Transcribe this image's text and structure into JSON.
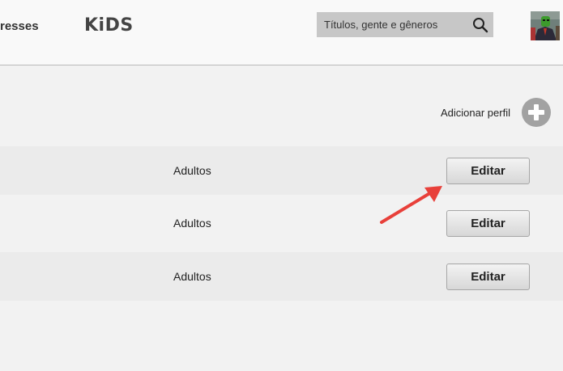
{
  "header": {
    "nav_partial": "resses",
    "kids_logo": "KiDS",
    "search": {
      "placeholder": "Títulos, gente e gêneros",
      "value": ""
    }
  },
  "add_profile": {
    "label": "Adicionar perfil",
    "icon": "plus-circle-icon"
  },
  "profiles": [
    {
      "type": "Adultos",
      "edit_label": "Editar"
    },
    {
      "type": "Adultos",
      "edit_label": "Editar"
    },
    {
      "type": "Adultos",
      "edit_label": "Editar"
    }
  ],
  "colors": {
    "annotation_arrow": "#e8403a",
    "search_bg": "#c7c7c7",
    "add_icon": "#a2a2a2"
  }
}
